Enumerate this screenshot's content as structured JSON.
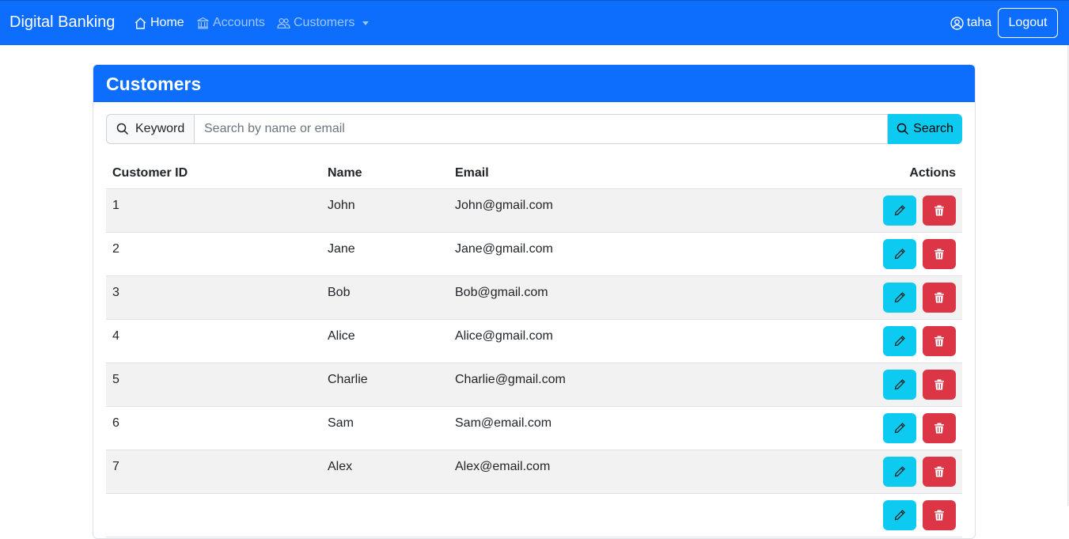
{
  "navbar": {
    "brand": "Digital Banking",
    "links": [
      {
        "label": "Home",
        "icon": "house-icon"
      },
      {
        "label": "Accounts",
        "icon": "bank-icon"
      },
      {
        "label": "Customers",
        "icon": "people-icon"
      }
    ],
    "user": "taha",
    "logout": "Logout",
    "color": "#0d6efd"
  },
  "card": {
    "title": "Customers",
    "search": {
      "prefix": "Keyword",
      "placeholder": "Search by name or email",
      "value": "",
      "button": "Search"
    },
    "table": {
      "columns": [
        "Customer ID",
        "Name",
        "Email",
        "Actions"
      ],
      "rows": [
        {
          "id": "1",
          "name": "John",
          "email": "John@gmail.com"
        },
        {
          "id": "2",
          "name": "Jane",
          "email": "Jane@gmail.com"
        },
        {
          "id": "3",
          "name": "Bob",
          "email": "Bob@gmail.com"
        },
        {
          "id": "4",
          "name": "Alice",
          "email": "Alice@gmail.com"
        },
        {
          "id": "5",
          "name": "Charlie",
          "email": "Charlie@gmail.com"
        },
        {
          "id": "6",
          "name": "Sam",
          "email": "Sam@email.com"
        },
        {
          "id": "7",
          "name": "Alex",
          "email": "Alex@email.com"
        },
        {
          "id": "",
          "name": "",
          "email": ""
        }
      ]
    },
    "colors": {
      "edit": "#0dcaf0",
      "delete": "#dc3545"
    }
  }
}
